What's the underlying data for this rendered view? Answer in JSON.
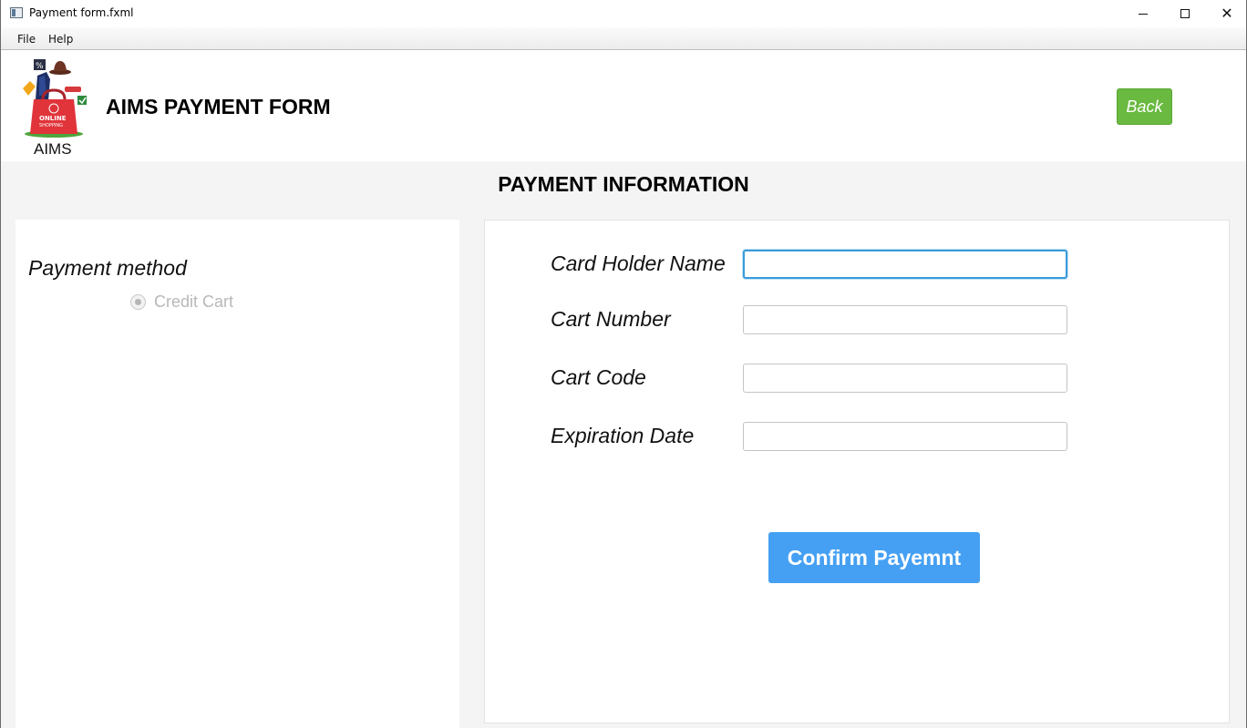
{
  "window": {
    "title": "Payment form.fxml",
    "minimize_icon": "minimize-icon",
    "maximize_icon": "maximize-icon",
    "close_icon": "close-icon",
    "close_glyph": "✕"
  },
  "menu": {
    "items": [
      {
        "label": "File"
      },
      {
        "label": "Help"
      }
    ]
  },
  "header": {
    "logo_caption": "AIMS",
    "logo_icon": "online-shopping-bag-logo",
    "title": "AIMS PAYMENT FORM",
    "back_label": "Back",
    "back_color": "#6ab940"
  },
  "main": {
    "section_title": "PAYMENT INFORMATION",
    "payment_method": {
      "label": "Payment method",
      "options": [
        {
          "label": "Credit Cart",
          "selected": true,
          "disabled": true
        }
      ]
    },
    "form": {
      "fields": [
        {
          "label": "Card Holder Name",
          "value": "",
          "focused": true
        },
        {
          "label": "Cart Number",
          "value": ""
        },
        {
          "label": "Cart Code",
          "value": ""
        },
        {
          "label": "Expiration Date",
          "value": ""
        }
      ],
      "confirm_label": "Confirm Payemnt",
      "confirm_color": "#45a0f3",
      "focus_color": "#3a9bd9"
    }
  }
}
